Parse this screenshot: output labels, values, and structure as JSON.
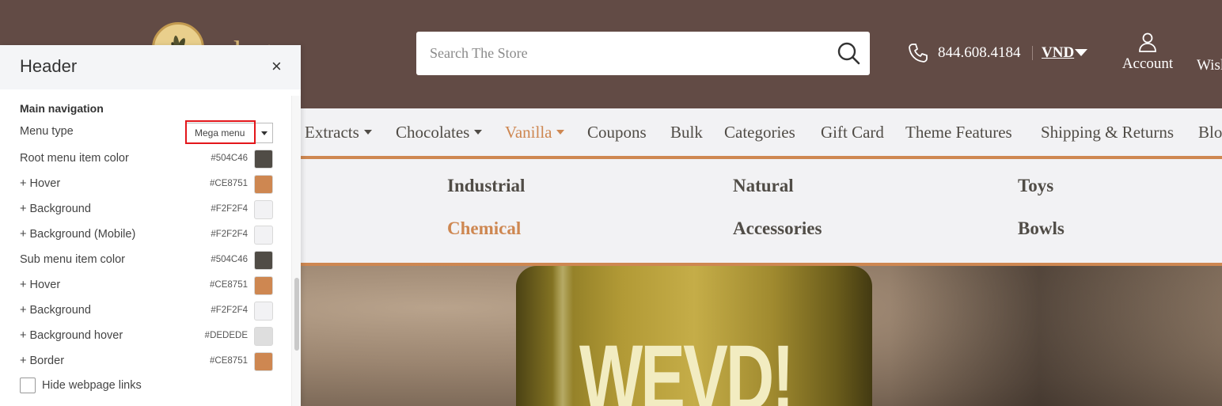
{
  "store": {
    "logo_text_visible": "arket",
    "search_placeholder": "Search The Store",
    "phone": "844.608.4184",
    "currency": "VND",
    "account_label": "Account",
    "wishlist_label": "Wisl"
  },
  "nav": {
    "items": [
      {
        "label": "Extracts",
        "dropdown": true
      },
      {
        "label": "Chocolates",
        "dropdown": true
      },
      {
        "label": "Vanilla",
        "dropdown": true,
        "active": true
      },
      {
        "label": "Coupons"
      },
      {
        "label": "Bulk"
      },
      {
        "label": "Categories"
      },
      {
        "label": "Gift Card"
      },
      {
        "label": "Theme Features"
      },
      {
        "label": "Shipping & Returns"
      },
      {
        "label": "Blo"
      }
    ]
  },
  "mega_menu": {
    "items": [
      "Industrial",
      "Natural",
      "Toys",
      "Chemical",
      "Accessories",
      "Bowls"
    ],
    "active_item": "Chemical"
  },
  "hero": {
    "bottle_text": "WEVD!"
  },
  "panel": {
    "title": "Header",
    "close_icon": "×",
    "section_title": "Main navigation",
    "menu_type_label": "Menu type",
    "menu_type_value": "Mega menu",
    "settings": [
      {
        "label": "Root menu item color",
        "hex": "#504C46",
        "color": "#504c46"
      },
      {
        "label": "+ Hover",
        "hex": "#CE8751",
        "color": "#ce8751"
      },
      {
        "label": "+ Background",
        "hex": "#F2F2F4",
        "color": "#f2f2f4"
      },
      {
        "label": "+ Background (Mobile)",
        "hex": "#F2F2F4",
        "color": "#f2f2f4"
      },
      {
        "label": "Sub menu item color",
        "hex": "#504C46",
        "color": "#504c46"
      },
      {
        "label": "+ Hover",
        "hex": "#CE8751",
        "color": "#ce8751"
      },
      {
        "label": "+ Background",
        "hex": "#F2F2F4",
        "color": "#f2f2f4"
      },
      {
        "label": "+ Background hover",
        "hex": "#DEDEDE",
        "color": "#dedede"
      },
      {
        "label": "+ Border",
        "hex": "#CE8751",
        "color": "#ce8751"
      }
    ],
    "hide_links_label": "Hide webpage links"
  },
  "colors": {
    "header_bg": "#624b45",
    "nav_text": "#504c46",
    "accent": "#ce8751",
    "nav_bg": "#f2f2f4",
    "highlight": "#e3161b"
  }
}
